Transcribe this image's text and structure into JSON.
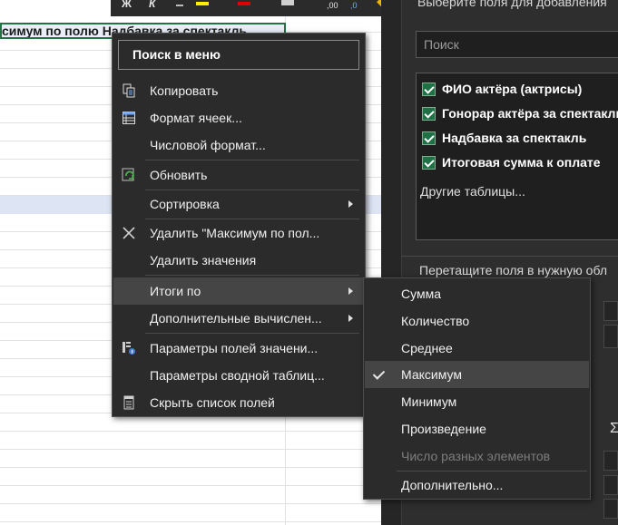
{
  "sheet": {
    "header_cell_text": "симум по полю Надбавка за спектакль"
  },
  "toolbar": {
    "bold": "Ж",
    "italic": "К",
    "dec_left": ",00",
    "dec_right": ",0"
  },
  "pane": {
    "title": "Выберите поля для добавления",
    "search_placeholder": "Поиск",
    "fields": [
      {
        "label": "ФИО актёра (актрисы)",
        "checked": true
      },
      {
        "label": "Гонорар актёра за спектакль",
        "checked": true
      },
      {
        "label": "Надбавка за спектакль",
        "checked": true
      },
      {
        "label": "Итоговая сумма к оплате",
        "checked": true
      }
    ],
    "other_tables": "Другие таблицы...",
    "drag_hint": "Перетащите поля в нужную обл",
    "sigma": "Σ"
  },
  "context_menu": {
    "search_label": "Поиск в меню",
    "items": [
      {
        "label": "Копировать",
        "icon": "copy-icon"
      },
      {
        "label": "Формат ячеек...",
        "icon": "format-cells-icon"
      },
      {
        "label": "Числовой формат...",
        "icon": ""
      },
      {
        "label": "Обновить",
        "icon": "refresh-icon"
      },
      {
        "label": "Сортировка",
        "icon": "",
        "submenu": true
      },
      {
        "label": "Удалить \"Максимум по пол...",
        "icon": "delete-x-icon"
      },
      {
        "label": "Удалить значения",
        "icon": ""
      },
      {
        "label": "Итоги по",
        "icon": "",
        "submenu": true,
        "active": true
      },
      {
        "label": "Дополнительные вычислен...",
        "icon": "",
        "submenu": true
      },
      {
        "label": "Параметры полей значени...",
        "icon": "field-settings-icon"
      },
      {
        "label": "Параметры сводной таблиц...",
        "icon": ""
      },
      {
        "label": "Скрыть список полей",
        "icon": "field-list-icon"
      }
    ]
  },
  "submenu": {
    "items": [
      {
        "label": "Сумма"
      },
      {
        "label": "Количество"
      },
      {
        "label": "Среднее"
      },
      {
        "label": "Максимум",
        "checked": true,
        "active": true
      },
      {
        "label": "Минимум"
      },
      {
        "label": "Произведение"
      },
      {
        "label": "Число разных элементов",
        "disabled": true
      },
      {
        "label": "Дополнительно..."
      }
    ]
  },
  "colors": {
    "menu_bg": "#2b2b2b",
    "menu_hover": "#454545",
    "excel_green": "#217346",
    "checkbox_green": "#1e7145"
  }
}
